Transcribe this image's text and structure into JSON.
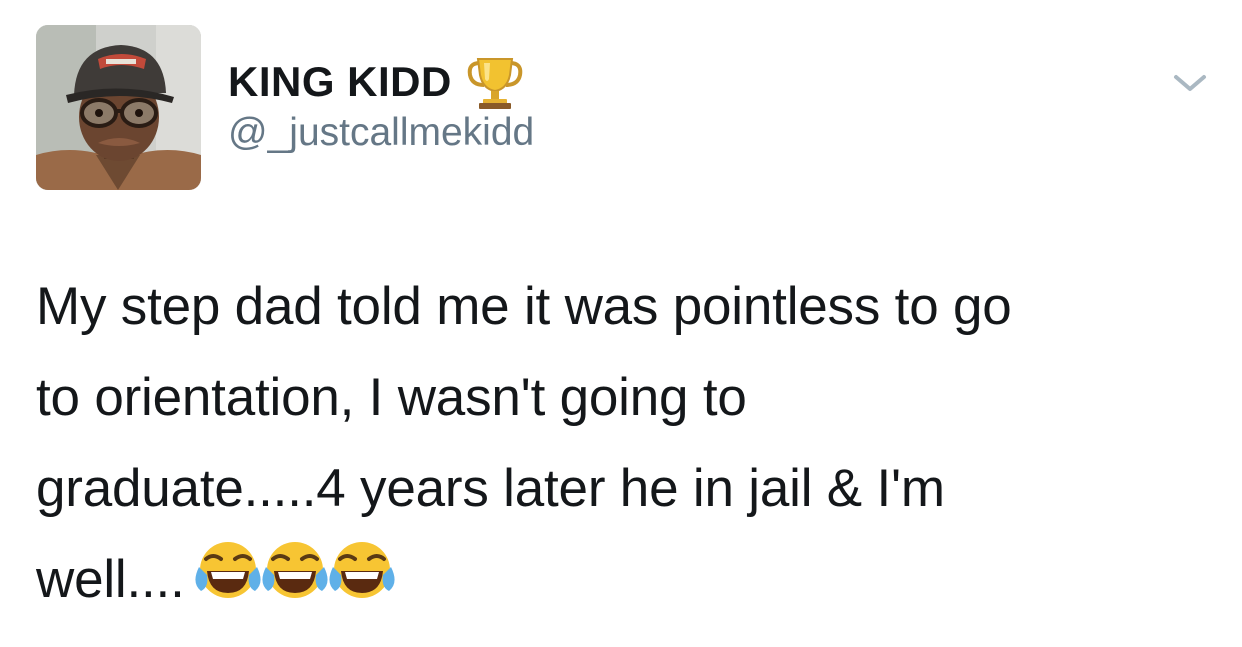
{
  "user": {
    "display_name": "KING KIDD",
    "handle": "@_justcallmekidd",
    "name_badge_icon": "trophy-icon",
    "avatar_icon": "profile-photo"
  },
  "tweet": {
    "text_lines": [
      "My step dad told me it was pointless to go",
      "to orientation, I wasn't going to",
      "graduate.....4 years later he in jail & I'm",
      "well...."
    ],
    "trailing_emojis": [
      "face-with-tears-of-joy",
      "face-with-tears-of-joy",
      "face-with-tears-of-joy"
    ]
  },
  "menu": {
    "icon": "chevron-down-icon"
  },
  "colors": {
    "text": "#14171a",
    "handle": "#657786",
    "chevron": "#aab8c2",
    "background": "#ffffff"
  }
}
